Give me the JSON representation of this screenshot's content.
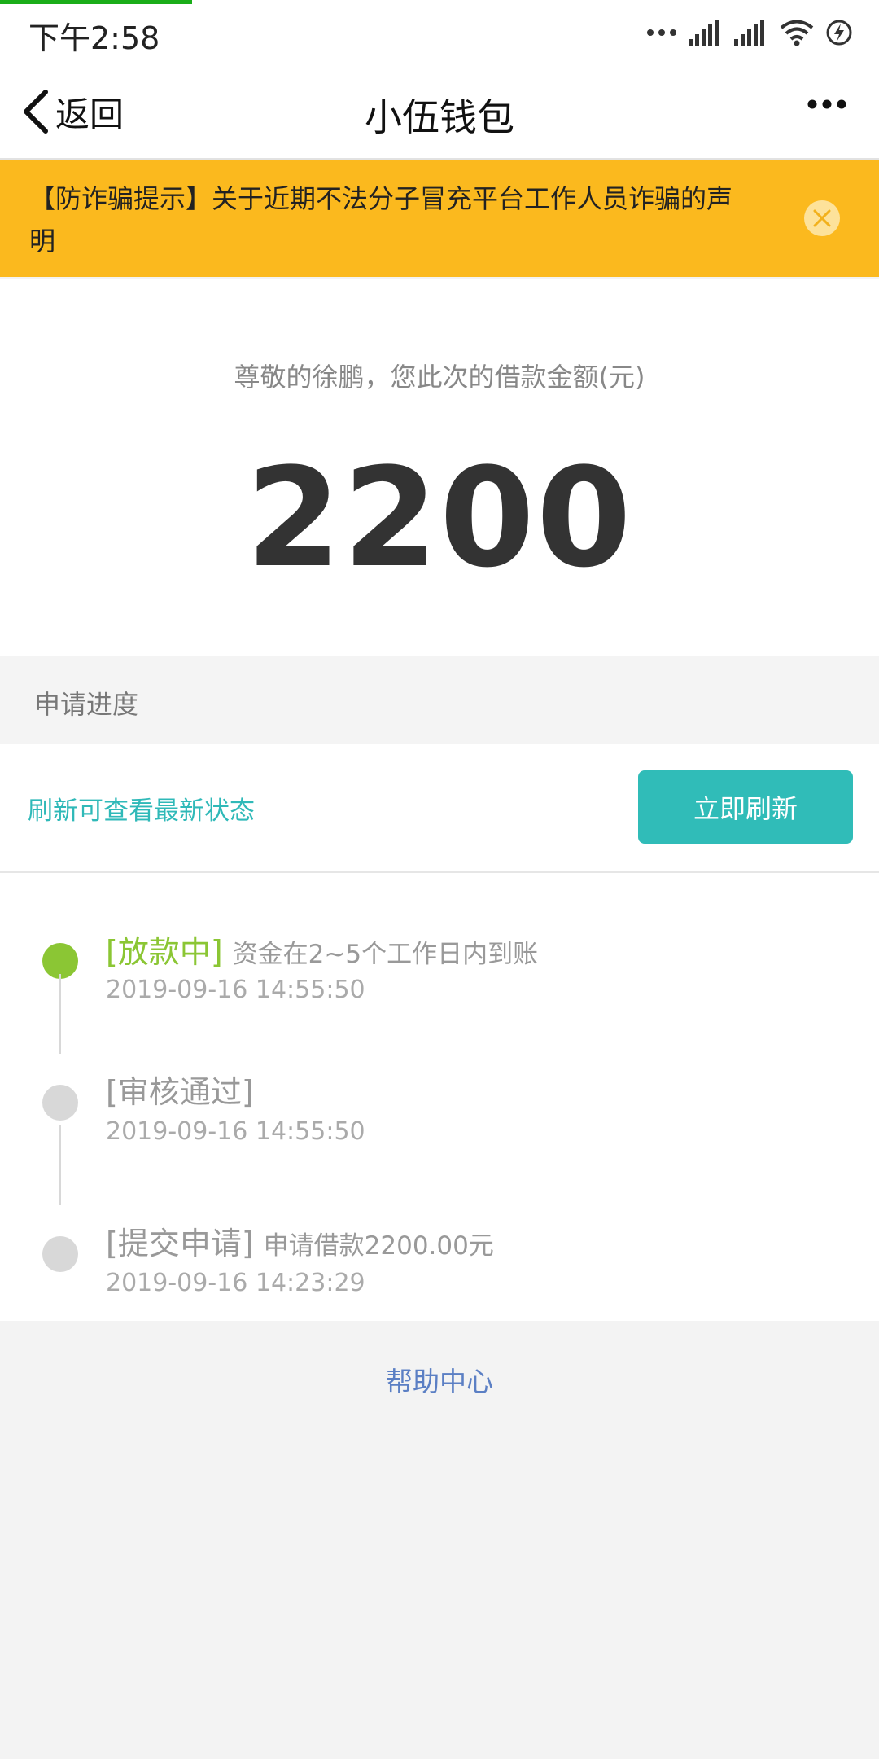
{
  "status_bar": {
    "time": "下午2:58"
  },
  "nav": {
    "back_label": "返回",
    "title": "小伍钱包"
  },
  "notice": {
    "text": "【防诈骗提示】关于近期不法分子冒充平台工作人员诈骗的声明"
  },
  "loan": {
    "greeting": "尊敬的徐鹏，您此次的借款金额(元)",
    "amount": "2200"
  },
  "progress": {
    "header": "申请进度",
    "refresh_hint": "刷新可查看最新状态",
    "refresh_button": "立即刷新",
    "steps": [
      {
        "title": "[放款中]",
        "desc": "资金在2~5个工作日内到账",
        "time": "2019-09-16 14:55:50",
        "active": true
      },
      {
        "title": "[审核通过]",
        "desc": "",
        "time": "2019-09-16 14:55:50",
        "active": false
      },
      {
        "title": "[提交申请]",
        "desc": "申请借款2200.00元",
        "time": "2019-09-16 14:23:29",
        "active": false
      }
    ]
  },
  "footer": {
    "help_link": "帮助中心"
  },
  "colors": {
    "accent": "#30bcb8",
    "notice_bg": "#fbb91e",
    "active_step": "#8bc634",
    "link": "#5b7fc4"
  }
}
